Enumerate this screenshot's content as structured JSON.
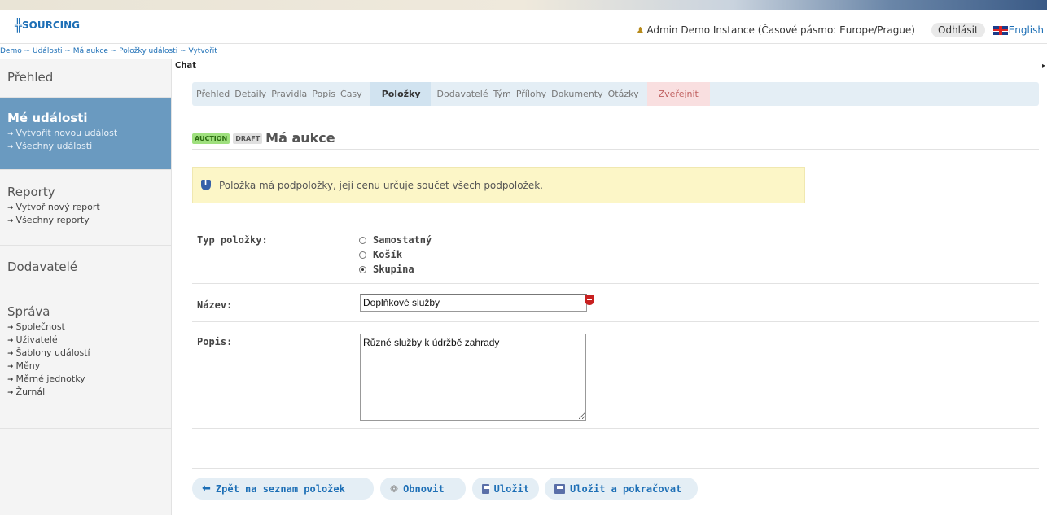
{
  "header": {
    "logo_text": "SOURCING",
    "user_label": "Admin Demo Instance (Časové pásmo: Europe/Prague)",
    "logout_label": "Odhlásit",
    "language_label": "English"
  },
  "breadcrumb": "Demo ~ Události ~ Má aukce ~ Položky události ~ Vytvořit",
  "sidebar": {
    "overview": "Přehled",
    "my_events": {
      "title": "Mé události",
      "links": [
        "Vytvořit novou událost",
        "Všechny události"
      ]
    },
    "reports": {
      "title": "Reporty",
      "links": [
        "Vytvoř nový report",
        "Všechny reporty"
      ]
    },
    "suppliers": "Dodavatelé",
    "admin": {
      "title": "Správa",
      "links": [
        "Společnost",
        "Uživatelé",
        "Šablony událostí",
        "Měny",
        "Měrné jednotky",
        "Žurnál"
      ]
    }
  },
  "chat": {
    "label": "Chat"
  },
  "steps": [
    "Přehled",
    "Detaily",
    "Pravidla",
    "Popis",
    "Časy",
    "Položky",
    "Dodavatelé",
    "Tým",
    "Přílohy",
    "Dokumenty",
    "Otázky",
    "Zveřejnit"
  ],
  "page": {
    "badge_auction": "AUCTION",
    "badge_draft": "DRAFT",
    "title": "Má aukce"
  },
  "notice": "Položka má podpoložky, její cenu určuje součet všech podpoložek.",
  "form": {
    "type_label": "Typ položky:",
    "type_options": [
      "Samostatný",
      "Košík",
      "Skupina"
    ],
    "type_selected": "Skupina",
    "name_label": "Název:",
    "name_value": "Doplňkové služby",
    "desc_label": "Popis:",
    "desc_value": "Různé služby k údržbě zahrady"
  },
  "actions": {
    "back": "Zpět na seznam položek",
    "refresh": "Obnovit",
    "save": "Uložit",
    "save_continue": "Uložit a pokračovat"
  },
  "colors": {
    "brand": "#1d6fb6",
    "sidebar_active": "#6a9ac0",
    "notice_bg": "#fcf6c7",
    "step_bg": "#e4eef5",
    "publish_bg": "#f9dfe0"
  }
}
